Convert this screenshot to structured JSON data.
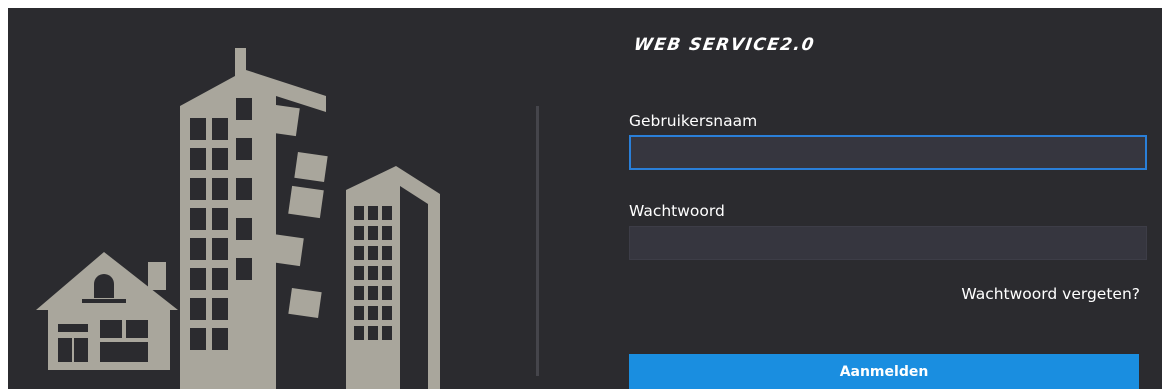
{
  "brand": {
    "title": "WEB SERVICE2.0"
  },
  "form": {
    "username_label": "Gebruikersnaam",
    "username_value": "",
    "password_label": "Wachtwoord",
    "password_value": "",
    "forgot_link": "Wachtwoord vergeten?",
    "login_button": "Aanmelden"
  },
  "colors": {
    "background": "#2b2b2f",
    "illustration": "#a9a69c",
    "field": "#36363f",
    "focus_border": "#2a7fd8",
    "accent": "#1a8ee0"
  },
  "icons": {
    "illustration": "city-buildings-and-house-illustration"
  }
}
